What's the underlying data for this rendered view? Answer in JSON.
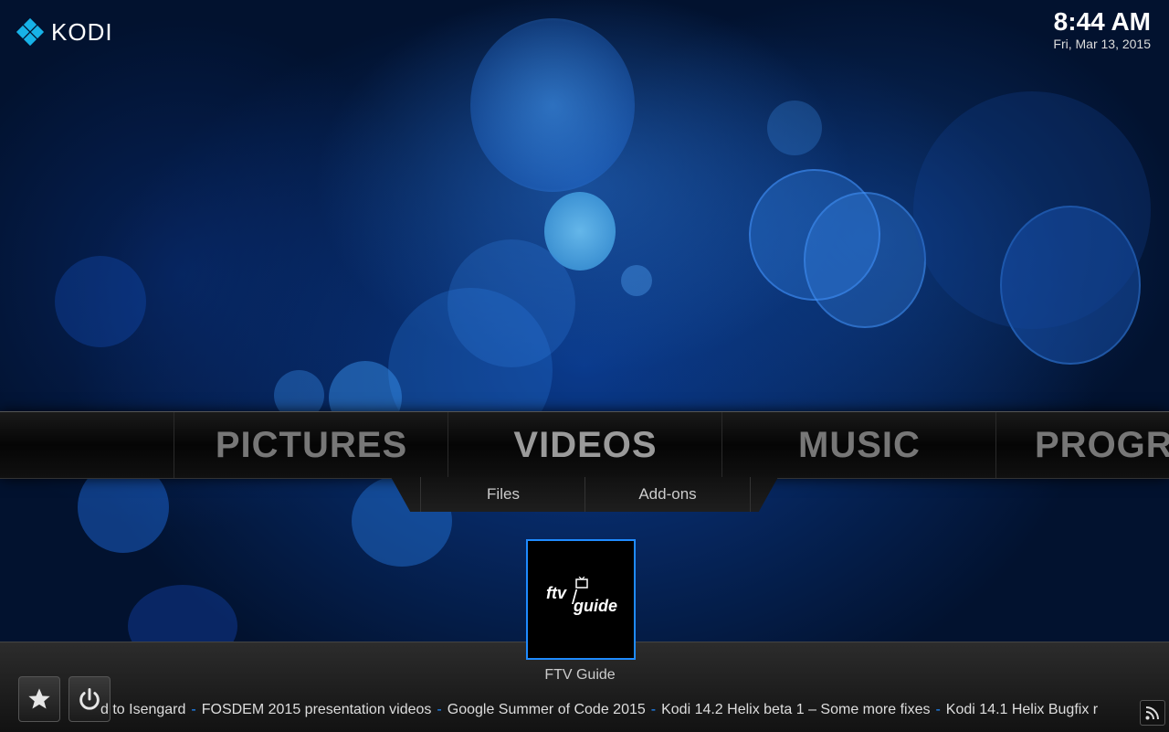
{
  "app": {
    "logo_text": "KODI"
  },
  "clock": {
    "time": "8:44 AM",
    "date": "Fri, Mar 13, 2015"
  },
  "menu": {
    "items": [
      {
        "label": "PICTURES"
      },
      {
        "label": "VIDEOS"
      },
      {
        "label": "MUSIC"
      },
      {
        "label": "PROGRA"
      }
    ],
    "active_index": 1,
    "submenu": [
      {
        "label": "Files"
      },
      {
        "label": "Add-ons"
      }
    ]
  },
  "tile": {
    "icon_text_top": "ftv",
    "icon_text_bottom": "guide",
    "label": "FTV Guide"
  },
  "ticker": {
    "items": [
      "d to Isengard",
      "FOSDEM 2015 presentation videos",
      "Google Summer of Code 2015",
      "Kodi 14.2 Helix beta 1 – Some more fixes",
      "Kodi 14.1 Helix Bugfix r"
    ],
    "separator": "-"
  },
  "icons": {
    "favourites": "star-icon",
    "power": "power-icon",
    "rss": "rss-icon"
  },
  "colors": {
    "accent": "#1f8bff",
    "logo": "#17b2e7"
  }
}
